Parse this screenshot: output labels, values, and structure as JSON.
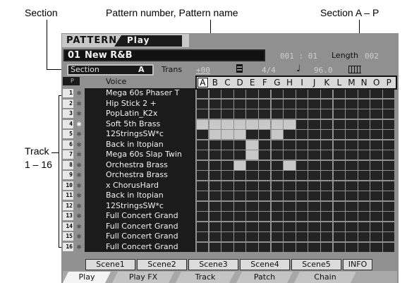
{
  "callouts": {
    "section": "Section",
    "pattern": "Pattern number, Pattern name",
    "section_range": "Section A – P",
    "track": "Track",
    "track_range": "1 – 16"
  },
  "header": {
    "title": "PATTERN",
    "mode": "Play"
  },
  "pattern": {
    "number": "01",
    "name": "New R&B",
    "position": "001 : 01",
    "length_label": "Length",
    "length_value": "002"
  },
  "status": {
    "section_label": "Section",
    "section_value": "A",
    "trans_label": "Trans",
    "trans_value": "+00",
    "time_sig": "4/4",
    "tempo": "96.0"
  },
  "grid": {
    "voice_header": "Voice",
    "sections": [
      "A",
      "B",
      "C",
      "D",
      "E",
      "F",
      "G",
      "H",
      "I",
      "J",
      "K",
      "L",
      "M",
      "N",
      "O",
      "P"
    ],
    "selected_section": "A",
    "tracks": [
      {
        "number": "1",
        "voice": "Mega 60s Phaser T"
      },
      {
        "number": "2",
        "voice": "Hip Stick 2 +"
      },
      {
        "number": "3",
        "voice": "PopLatin_K2x"
      },
      {
        "number": "4",
        "voice": "Soft 5th Brass"
      },
      {
        "number": "5",
        "voice": "12StringsSW*c"
      },
      {
        "number": "6",
        "voice": "Back in Itopian"
      },
      {
        "number": "7",
        "voice": "Mega 60s Slap Twin"
      },
      {
        "number": "8",
        "voice": "Orchestra Brass"
      },
      {
        "number": "9",
        "voice": "Orchestra Brass"
      },
      {
        "number": "10",
        "voice": "x ChorusHard"
      },
      {
        "number": "11",
        "voice": "Back in Itopian"
      },
      {
        "number": "12",
        "voice": "12StringsSW*c"
      },
      {
        "number": "13",
        "voice": "Full Concert Grand"
      },
      {
        "number": "14",
        "voice": "Full Concert Grand"
      },
      {
        "number": "15",
        "voice": "Full Concert Grand"
      },
      {
        "number": "16",
        "voice": "Full Concert Grand"
      }
    ],
    "filled_cells": [
      [
        3,
        0
      ],
      [
        3,
        1
      ],
      [
        3,
        2
      ],
      [
        3,
        3
      ],
      [
        3,
        4
      ],
      [
        3,
        5
      ],
      [
        3,
        6
      ],
      [
        3,
        7
      ],
      [
        4,
        1
      ],
      [
        4,
        2
      ],
      [
        4,
        3
      ],
      [
        4,
        6
      ],
      [
        5,
        4
      ],
      [
        6,
        4
      ],
      [
        7,
        3
      ],
      [
        7,
        7
      ]
    ]
  },
  "scenes": [
    "Scene1",
    "Scene2",
    "Scene3",
    "Scene4",
    "Scene5",
    "INFO"
  ],
  "tabs": [
    "Play",
    "Play FX",
    "Track",
    "Patch",
    "Chain"
  ],
  "active_tab": "Play",
  "colors": {
    "lcd_bg": "#909090",
    "grid_cell": "#232323",
    "grid_filled": "#c8c8c8",
    "text_light": "#f0f0f0"
  }
}
